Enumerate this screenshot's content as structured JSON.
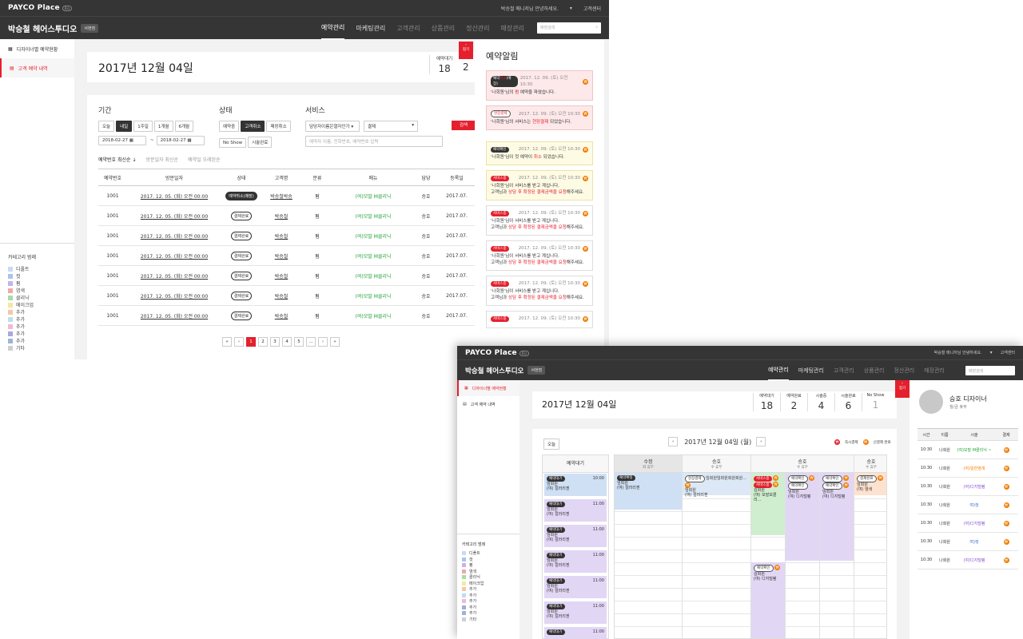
{
  "app": {
    "logo": "PAYCO Place",
    "logo_tag": "Biz",
    "greeting": "박승철 매니저님 안녕하세요.",
    "help": "고객센터",
    "shop": "박승철 헤어스투디오",
    "branch": "서현점",
    "nav": [
      "예약관리",
      "마케팅관리",
      "고객관리",
      "상품관리",
      "정산관리",
      "매장관리"
    ],
    "search_placeholder": "매장검색"
  },
  "win1": {
    "sidebar": [
      "디자이너별 예약현황",
      "고객 예약 내역"
    ],
    "date": "2017년 12월 04일",
    "stat_label": "예약대기",
    "stat_value": "18",
    "stat_value2": "2",
    "tab_label": "접기",
    "filter": {
      "period_label": "기간",
      "period_btns": [
        "오늘",
        "내일",
        "1주일",
        "1개월",
        "6개월"
      ],
      "date_from": "2018-02-27",
      "date_to": "2018-02-27",
      "tilde": "~",
      "status_label": "상태",
      "status_btns": [
        "예약중",
        "고객취소",
        "매장취소",
        "No Show",
        "시술완료"
      ],
      "service_label": "서비스",
      "select1": "담당자이름은열자인가",
      "select2": "결제",
      "keyword_placeholder": "예약자 이름, 전화번호, 예약번호 입력",
      "search_btn": "검색"
    },
    "sort": [
      "예약번호 최신순 ↓",
      "방문일자 최신순",
      "예약일 오래된순"
    ],
    "columns": [
      "예약번호",
      "방문일자",
      "상태",
      "고객명",
      "분류",
      "메뉴",
      "담당",
      "등록일"
    ],
    "rows": [
      {
        "id": "1001",
        "visit": "2017. 12. 05. (화) 오전 00:00",
        "status": "예약취소(매장)",
        "name": "박승철박승",
        "cat": "펌",
        "menu": "(여)모발 M클리닉",
        "staff": "승호",
        "reg": "2017.07."
      },
      {
        "id": "1001",
        "visit": "2017. 12. 05. (화) 오전 00:00",
        "status": "결제완료",
        "name": "박승철",
        "cat": "펌",
        "menu": "(여)모발 M클리닉",
        "staff": "승호",
        "reg": "2017.07."
      },
      {
        "id": "1001",
        "visit": "2017. 12. 05. (화) 오전 00:00",
        "status": "결제완료",
        "name": "박승철",
        "cat": "펌",
        "menu": "(여)모발 M클리닉",
        "staff": "승호",
        "reg": "2017.07."
      },
      {
        "id": "1001",
        "visit": "2017. 12. 05. (화) 오전 00:00",
        "status": "결제완료",
        "name": "박승철",
        "cat": "펌",
        "menu": "(여)모발 M클리닉",
        "staff": "승호",
        "reg": "2017.07."
      },
      {
        "id": "1001",
        "visit": "2017. 12. 05. (화) 오전 00:00",
        "status": "결제완료",
        "name": "박승철",
        "cat": "펌",
        "menu": "(여)모발 M클리닉",
        "staff": "승호",
        "reg": "2017.07."
      },
      {
        "id": "1001",
        "visit": "2017. 12. 05. (화) 오전 00:00",
        "status": "결제완료",
        "name": "박승철",
        "cat": "펌",
        "menu": "(여)모발 M클리닉",
        "staff": "승호",
        "reg": "2017.07."
      },
      {
        "id": "1001",
        "visit": "2017. 12. 05. (화) 오전 00:00",
        "status": "결제완료",
        "name": "박승철",
        "cat": "펌",
        "menu": "(여)모발 M클리닉",
        "staff": "승호",
        "reg": "2017.07."
      }
    ],
    "pages": [
      "«",
      "‹",
      "1",
      "2",
      "3",
      "4",
      "5",
      "...",
      "›",
      "»"
    ]
  },
  "categories": {
    "title": "카테고리 범례",
    "items": [
      {
        "label": "디폴트",
        "color": "#c9daf0"
      },
      {
        "label": "컷",
        "color": "#a9c4ea"
      },
      {
        "label": "펌",
        "color": "#c7b3e8"
      },
      {
        "label": "염색",
        "color": "#f4a6a6"
      },
      {
        "label": "클리닉",
        "color": "#a6dca8"
      },
      {
        "label": "메이크업",
        "color": "#f6e7a0"
      },
      {
        "label": "추가",
        "color": "#f8c7a1"
      },
      {
        "label": "추가",
        "color": "#b8e0f0"
      },
      {
        "label": "추가",
        "color": "#f0b9d5"
      },
      {
        "label": "추가",
        "color": "#a9a9d8"
      },
      {
        "label": "추가",
        "color": "#9fb3d6"
      },
      {
        "label": "기타",
        "color": "#cfcfcf"
      }
    ]
  },
  "notifications": {
    "title": "예약알림",
    "items": [
      {
        "tag": "예약취소(매장)",
        "time": "2017. 12. 09. (토) 오전 10:30",
        "text": "'나회원'님의 펌 예약을 파였습니다.",
        "style": "pk",
        "chip": "dk"
      },
      {
        "tag": "현장결제",
        "time": "2017. 12. 09. (토) 오전 10:30",
        "text": "'나회원'님의 서비스는 현장결제 되었습니다.",
        "style": "pk",
        "chip": "ol"
      },
      {
        "tag": "예약확인",
        "time": "2017. 12. 09. (토) 오전 10:30",
        "text": "'나회원'님이 컷 예약이 취소 되었습니다.",
        "style": "yl",
        "chip": "dk"
      },
      {
        "tag": "서비스중",
        "time": "2017. 12. 09. (토) 오전 10:30",
        "text": "'나회원'님이 서비스를 받고 계십니다.",
        "text2": "고객님과 상담 후 확정된 결제금액을 요청해주세요.",
        "style": "yl",
        "chip": "rd"
      },
      {
        "tag": "서비스중",
        "time": "2017. 12. 09. (토) 오전 10:30",
        "text": "'나회원'님이 서비스를 받고 계십니다.",
        "text2": "고객님과 상담 후 확정된 결제금액을 요청해주세요.",
        "style": "",
        "chip": "rd"
      },
      {
        "tag": "서비스중",
        "time": "2017. 12. 09. (토) 오전 10:30",
        "text": "'나회원'님이 서비스를 받고 계십니다.",
        "text2": "고객님과 상담 후 확정된 결제금액을 요청해주세요.",
        "style": "",
        "chip": "rd"
      },
      {
        "tag": "서비스중",
        "time": "2017. 12. 09. (토) 오전 10:30",
        "text": "'나회원'님이 서비스를 받고 계십니다.",
        "text2": "고객님과 상담 후 확정된 결제금액을 요청해주세요.",
        "style": "",
        "chip": "rd"
      },
      {
        "tag": "서비스중",
        "time": "2017. 12. 09. (토) 오전 10:30",
        "text": "",
        "style": "",
        "chip": "rd"
      }
    ]
  },
  "win2": {
    "sidebar": [
      "디자이너별 예약현황",
      "고객 예약 내역"
    ],
    "date": "2017년 12월 04일",
    "stats": [
      {
        "label": "예약대기",
        "value": "18"
      },
      {
        "label": "예약완료",
        "value": "2"
      },
      {
        "label": "시술중",
        "value": "4"
      },
      {
        "label": "시술완료",
        "value": "6"
      },
      {
        "label": "No Show",
        "value": "1"
      }
    ],
    "today_btn": "오늘",
    "cal_date": "2017년 12월 04일 (월)",
    "legend1": "즉시결제",
    "legend2": "선결제 완료",
    "waiting_title": "예약대기",
    "waiting": [
      {
        "tag": "예약대기",
        "time": "10:00",
        "name": "임회원",
        "menu": "(여) 컬러리젠"
      },
      {
        "tag": "예약대기",
        "time": "11:00",
        "name": "임회원",
        "menu": "(여) 컬러리젠"
      },
      {
        "tag": "예약대기",
        "time": "11:00",
        "name": "임회원",
        "menu": "(여) 컬러리젠"
      },
      {
        "tag": "예약대기",
        "time": "11:00",
        "name": "임회원",
        "menu": "(여) 컬러리젠"
      },
      {
        "tag": "예약대기",
        "time": "11:00",
        "name": "임회원",
        "menu": "(여) 컬러리젠"
      },
      {
        "tag": "예약대기",
        "time": "11:00",
        "name": "임회원",
        "menu": "(여) 컬러리젠"
      },
      {
        "tag": "예약대기",
        "time": "11:00",
        "name": "",
        "menu": ""
      }
    ],
    "designers": [
      {
        "name": "수정",
        "sub": "화 휴무"
      },
      {
        "name": "승호",
        "sub": "수 휴무"
      },
      {
        "name": "승호",
        "sub": "수 휴무"
      },
      {
        "name": "승호",
        "sub": "수 휴무"
      }
    ],
    "slot_a": {
      "tag": "예약확정",
      "name": "임회원",
      "menu": "(여) 컬러리젠"
    },
    "slot_b": {
      "tag": "현장결제",
      "text": "임회원임회원회원회원...",
      "name": "임회원",
      "menu": "(여) 컬러리젠"
    },
    "slot_c": {
      "tag": "서비스중",
      "name": "김회원",
      "menu": "(여) 모발보클리..."
    },
    "slot_d": {
      "tag": "예약확인",
      "name": "임회원",
      "menu": "(여) 디지털펌"
    },
    "slot_e": {
      "tag": "예약확인",
      "name": "임회원",
      "menu": "(여) 디지털펌"
    },
    "slot_f": {
      "tag": "결제완료",
      "name": "임회원",
      "menu": "(여) 염색"
    },
    "slot_g": {
      "tag": "예약확인",
      "name": "김회원",
      "menu": "(여) 디지털펌"
    },
    "profile": {
      "name": "승호 디자이너",
      "sub": "월/금 휴무"
    },
    "rtable_cols": [
      "시간",
      "이름",
      "시술",
      "결제"
    ],
    "rtable": [
      {
        "t": "10:30",
        "n": "나회원",
        "s": "(여)모발 M클리닉 ~",
        "c": "#22a53a"
      },
      {
        "t": "10:30",
        "n": "나회원",
        "s": "(여)일반염색",
        "c": "#f07d00"
      },
      {
        "t": "10:30",
        "n": "나회원",
        "s": "(여)디지털펌",
        "c": "#8a4fd0"
      },
      {
        "t": "10:30",
        "n": "나회원",
        "s": "여)컷",
        "c": "#3366cc"
      },
      {
        "t": "10:30",
        "n": "나회원",
        "s": "(여)디지털펌",
        "c": "#8a4fd0"
      },
      {
        "t": "10:30",
        "n": "나회원",
        "s": "여)컷",
        "c": "#3366cc"
      },
      {
        "t": "10:30",
        "n": "나회원",
        "s": "(여)디지털펌",
        "c": "#8a4fd0"
      }
    ]
  }
}
